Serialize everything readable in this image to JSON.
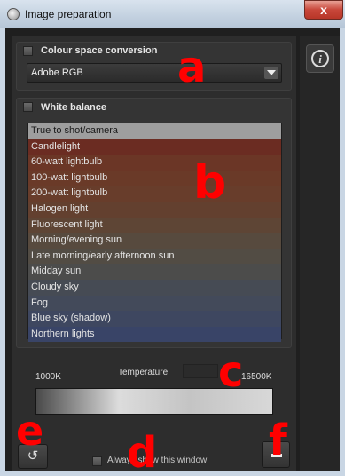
{
  "window": {
    "title": "Image preparation",
    "close_label": "x"
  },
  "colour_space": {
    "label": "Colour space conversion",
    "selected": "Adobe RGB"
  },
  "white_balance": {
    "label": "White balance",
    "selected_index": 0,
    "items": [
      {
        "label": "True to shot/camera",
        "color": "#9e9e9e"
      },
      {
        "label": "Candlelight",
        "color": "#6b2c22"
      },
      {
        "label": "60-watt lightbulb",
        "color": "#6b3626"
      },
      {
        "label": "100-watt lightbulb",
        "color": "#6a3a28"
      },
      {
        "label": "200-watt lightbulb",
        "color": "#683d2b"
      },
      {
        "label": "Halogen light",
        "color": "#63402f"
      },
      {
        "label": "Fluorescent light",
        "color": "#5e4535"
      },
      {
        "label": "Morning/evening sun",
        "color": "#574a3e"
      },
      {
        "label": "Late morning/early afternoon sun",
        "color": "#524c44"
      },
      {
        "label": "Midday sun",
        "color": "#4c4c4b"
      },
      {
        "label": "Cloudy sky",
        "color": "#464b54"
      },
      {
        "label": "Fog",
        "color": "#434a5a"
      },
      {
        "label": "Blue sky (shadow)",
        "color": "#3e4760"
      },
      {
        "label": "Northern lights",
        "color": "#394467"
      }
    ]
  },
  "temperature": {
    "label": "Temperature",
    "min_label": "1000K",
    "max_label": "16500K"
  },
  "footer": {
    "always_show_label": "Always show this window",
    "reset_icon": "↺"
  },
  "info_icon": "i",
  "markers": {
    "a": "a",
    "b": "b",
    "c": "c",
    "d": "d",
    "e": "e",
    "f": "f"
  }
}
